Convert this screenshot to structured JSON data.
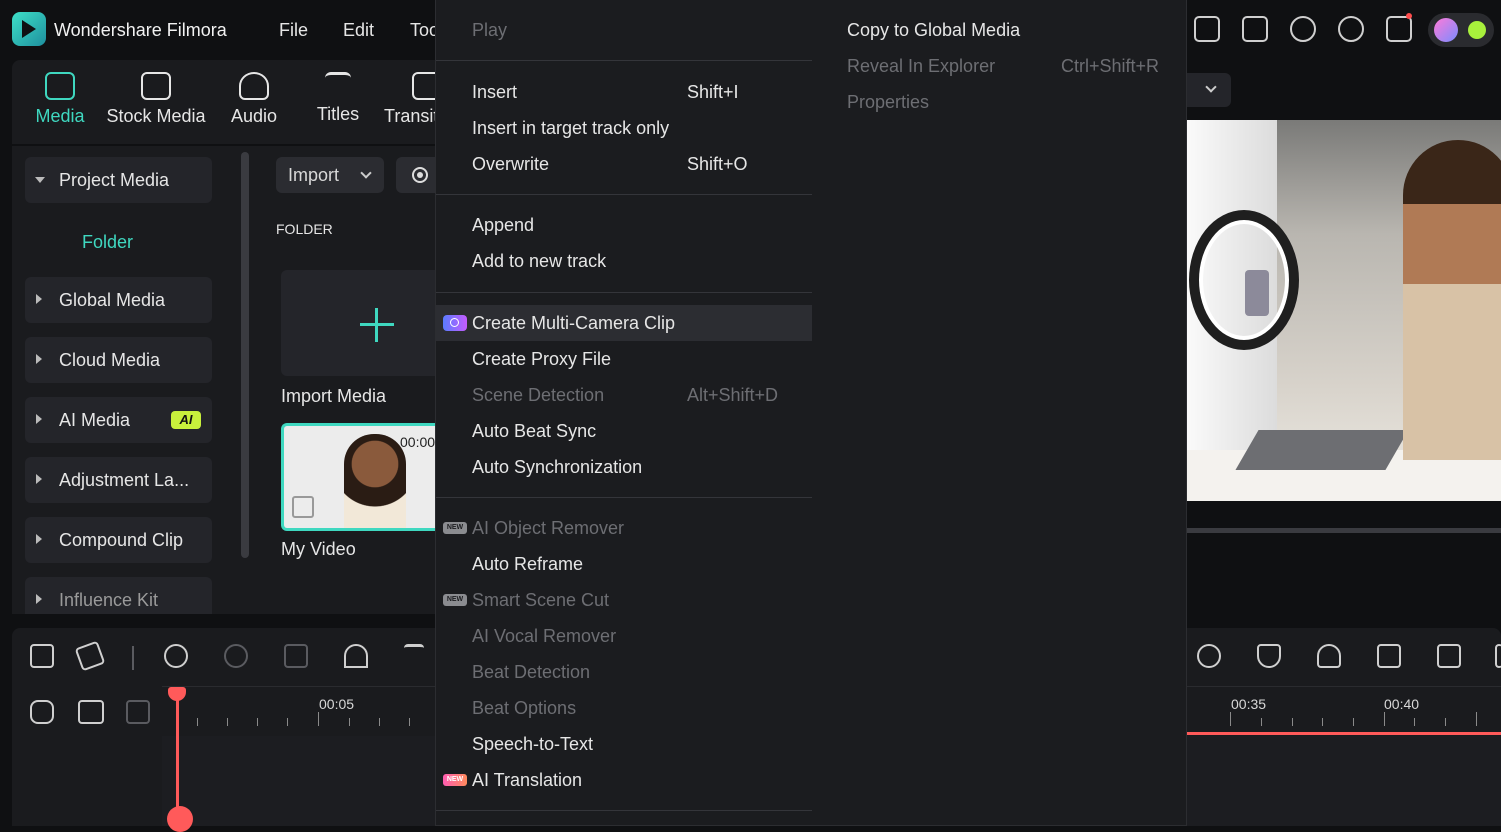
{
  "app": {
    "title": "Wondershare Filmora",
    "menu": [
      "File",
      "Edit",
      "Too"
    ]
  },
  "media_tabs": [
    {
      "label": "Media",
      "icon": "media-icon",
      "active": true
    },
    {
      "label": "Stock Media",
      "icon": "stock-media-icon",
      "active": false
    },
    {
      "label": "Audio",
      "icon": "music-note-icon",
      "active": false
    },
    {
      "label": "Titles",
      "icon": "titles-icon",
      "active": false
    },
    {
      "label": "Transiti",
      "icon": "transition-icon",
      "active": false
    }
  ],
  "sidebar": {
    "project_media": "Project Media",
    "folder": "Folder",
    "items": [
      "Global Media",
      "Cloud Media",
      "AI Media",
      "Adjustment La...",
      "Compound Clip",
      "Influence Kit"
    ],
    "ai_badge": "AI"
  },
  "media_panel": {
    "import_label": "Import",
    "folder_heading": "FOLDER",
    "import_media_label": "Import Media",
    "video_label": "My Video",
    "video_time": "00:00"
  },
  "context_menu": {
    "left": [
      {
        "label": "Play",
        "shortcut": "",
        "disabled": true
      },
      {
        "label": "Insert",
        "shortcut": "Shift+I",
        "disabled": false
      },
      {
        "label": "Insert in target track only",
        "shortcut": "",
        "disabled": false
      },
      {
        "label": "Overwrite",
        "shortcut": "Shift+O",
        "disabled": false
      },
      {
        "label": "Append",
        "shortcut": "",
        "disabled": false
      },
      {
        "label": "Add to new track",
        "shortcut": "",
        "disabled": false
      },
      {
        "label": "Create Multi-Camera Clip",
        "shortcut": "",
        "disabled": false,
        "highlighted": true,
        "icon": "multi-camera-icon"
      },
      {
        "label": "Create Proxy File",
        "shortcut": "",
        "disabled": false
      },
      {
        "label": "Scene Detection",
        "shortcut": "Alt+Shift+D",
        "disabled": true
      },
      {
        "label": "Auto Beat Sync",
        "shortcut": "",
        "disabled": false
      },
      {
        "label": "Auto Synchronization",
        "shortcut": "",
        "disabled": false
      },
      {
        "label": "AI Object Remover",
        "shortcut": "",
        "disabled": true,
        "badge": "NEW"
      },
      {
        "label": "Auto Reframe",
        "shortcut": "",
        "disabled": false
      },
      {
        "label": "Smart Scene Cut",
        "shortcut": "",
        "disabled": true,
        "badge": "NEW"
      },
      {
        "label": "AI Vocal Remover",
        "shortcut": "",
        "disabled": true
      },
      {
        "label": "Beat Detection",
        "shortcut": "",
        "disabled": true
      },
      {
        "label": "Beat Options",
        "shortcut": "",
        "disabled": true
      },
      {
        "label": "Speech-to-Text",
        "shortcut": "",
        "disabled": false
      },
      {
        "label": "AI Translation",
        "shortcut": "",
        "disabled": false,
        "badge": "NEW"
      }
    ],
    "right": [
      {
        "label": "Copy to Global Media",
        "shortcut": "",
        "disabled": false
      },
      {
        "label": "Reveal In Explorer",
        "shortcut": "Ctrl+Shift+R",
        "disabled": true
      },
      {
        "label": "Properties",
        "shortcut": "",
        "disabled": true
      }
    ]
  },
  "timeline": {
    "ruler_labels": [
      "00:05",
      "00:35",
      "00:40"
    ]
  },
  "colors": {
    "accent": "#3fd8c0",
    "playhead": "#ff5a5a",
    "ai_badge": "#c8f03c"
  }
}
